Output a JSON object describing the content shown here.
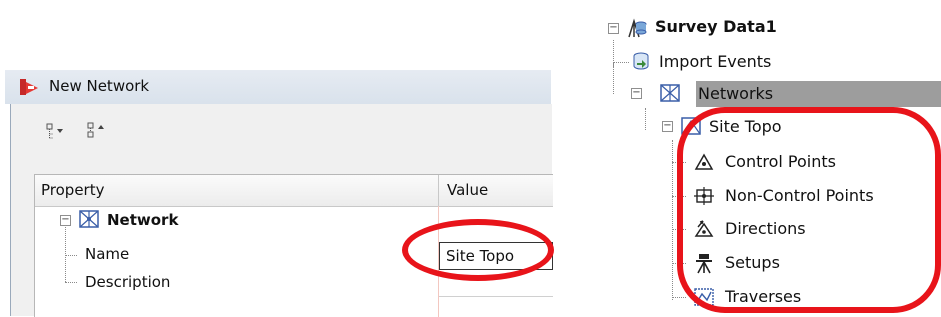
{
  "dialog": {
    "title": "New Network",
    "toolbar": {
      "sort_icon": "categorized-sort-icon",
      "alpha_icon": "alphabetical-sort-icon"
    },
    "grid": {
      "columns": {
        "property": "Property",
        "value": "Value"
      },
      "category": "Network",
      "rows": [
        {
          "property": "Name",
          "value": "Site Topo"
        },
        {
          "property": "Description",
          "value": ""
        }
      ]
    }
  },
  "tree": {
    "root": "Survey Data1",
    "import_events": "Import Events",
    "networks": "Networks",
    "network": "Site Topo",
    "children": [
      {
        "label": "Control Points",
        "icon": "control-points-icon"
      },
      {
        "label": "Non-Control Points",
        "icon": "non-control-points-icon"
      },
      {
        "label": "Directions",
        "icon": "directions-icon"
      },
      {
        "label": "Setups",
        "icon": "setups-icon"
      },
      {
        "label": "Traverses",
        "icon": "traverses-icon"
      }
    ]
  },
  "colors": {
    "highlight": "#e8141a",
    "selection": "#9d9d9d",
    "network_icon": "#3a5ea8"
  }
}
